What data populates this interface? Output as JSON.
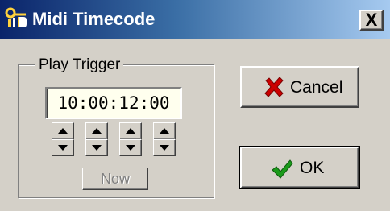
{
  "window": {
    "title": "Midi Timecode",
    "app_icon": "midi-app-icon",
    "close_label": "X"
  },
  "play_trigger": {
    "group_label": "Play Trigger",
    "timecode_value": "10:00:12:00",
    "spinners": [
      {
        "name": "hours-spinner",
        "up_icon": "arrow-up-icon",
        "down_icon": "arrow-down-icon"
      },
      {
        "name": "minutes-spinner",
        "up_icon": "arrow-up-icon",
        "down_icon": "arrow-down-icon"
      },
      {
        "name": "seconds-spinner",
        "up_icon": "arrow-up-icon",
        "down_icon": "arrow-down-icon"
      },
      {
        "name": "frames-spinner",
        "up_icon": "arrow-up-icon",
        "down_icon": "arrow-down-icon"
      }
    ],
    "now_label": "Now",
    "now_enabled": false
  },
  "buttons": {
    "cancel_label": "Cancel",
    "cancel_icon": "red-x-icon",
    "ok_label": "OK",
    "ok_icon": "green-check-icon"
  },
  "colors": {
    "title_gradient_start": "#0a246a",
    "title_gradient_end": "#a6caf0",
    "face": "#d4d0c8",
    "field_bg": "#ffffee",
    "cancel_icon": "#cc0000",
    "ok_icon": "#1a9a1a"
  }
}
